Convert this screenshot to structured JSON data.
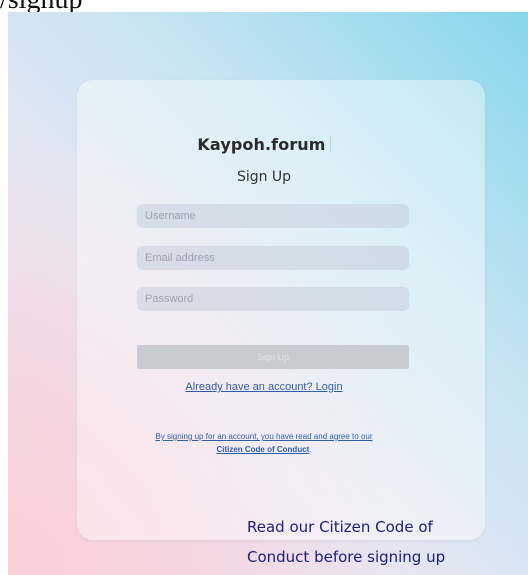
{
  "route": "/signup",
  "brand": "Kaypoh.forum",
  "heading": "Sign Up",
  "form": {
    "username_placeholder": "Username",
    "email_placeholder": "Email address",
    "password_placeholder": "Password",
    "submit_label": "Sign Up"
  },
  "login_link": "Already have an account? Login",
  "terms": {
    "line1": "By signing up for an account, you have read and agree to our",
    "link": "Citizen Code of Conduct",
    "suffix": "."
  },
  "annotation": {
    "line1": "Read our Citizen Code of",
    "line2": "Conduct before signing up"
  },
  "colors": {
    "link": "#2d5fa8",
    "annotation": "#1b1f7a",
    "button_disabled": "#c8cbd1"
  }
}
